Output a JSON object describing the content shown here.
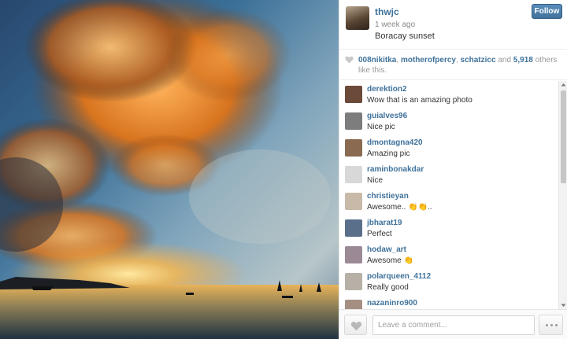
{
  "post": {
    "owner": "thwjc",
    "time_ago": "1 week ago",
    "caption": "Boracay sunset",
    "follow_label": "Follow"
  },
  "likes": {
    "users": [
      "008nikitka",
      "motherofpercy",
      "schatzicc"
    ],
    "sep1": ", ",
    "sep2": ", ",
    "and_text": " and ",
    "count": "5,918",
    "suffix": " others like this."
  },
  "comments": [
    {
      "user": "derektion2",
      "text": "Wow that is an amazing photo",
      "avatar_color": "#6b4a3a"
    },
    {
      "user": "guialves96",
      "text": "Nice pic",
      "avatar_color": "#7d7d7d"
    },
    {
      "user": "dmontagna420",
      "text": "Amazing pic",
      "avatar_color": "#8a6a50"
    },
    {
      "user": "raminbonakdar",
      "text": "Nice",
      "avatar_color": "#d8d8d8"
    },
    {
      "user": "christieyan",
      "text": "Awesome.. 👏👏..",
      "avatar_color": "#c9b9a8"
    },
    {
      "user": "jbharat19",
      "text": "Perfect",
      "avatar_color": "#5a6f8a"
    },
    {
      "user": "hodaw_art",
      "text": "Awesome 👏",
      "avatar_color": "#9b8a96"
    },
    {
      "user": "polarqueen_4112",
      "text": "Really good",
      "avatar_color": "#b7b0a6"
    },
    {
      "user": "nazaninro900",
      "text": "",
      "avatar_color": "#a58f82"
    }
  ],
  "composer": {
    "placeholder": "Leave a comment..."
  },
  "icons": {
    "likes_heart": "heart-icon",
    "like_button": "heart-icon",
    "more_button": "ellipsis-icon",
    "scroll_up": "triangle-up-icon",
    "scroll_down": "triangle-down-icon"
  },
  "colors": {
    "link": "#3f729b",
    "follow_button": "#3f729b",
    "muted": "#999999"
  }
}
